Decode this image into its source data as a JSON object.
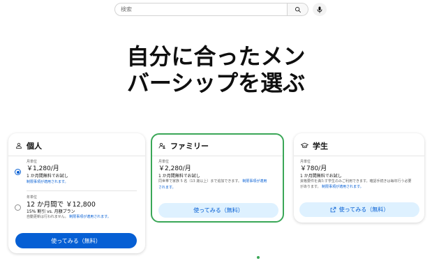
{
  "search": {
    "placeholder": "検索"
  },
  "headline": {
    "line1": "自分に合ったメン",
    "line2": "バーシップを選ぶ"
  },
  "individual": {
    "title": "個人",
    "monthly": {
      "label": "月単位",
      "price": "￥1,280/月",
      "trial": "1 か月間無料でお試し",
      "terms": "制限事項が適用されます。"
    },
    "annual": {
      "label": "年単位",
      "price": "12 か月間で ￥12,800",
      "discount": "15% 割引 vs. 月額プラン",
      "renewal_note": "自動更新は行われません。",
      "terms": "制限事項が適用されます。"
    },
    "button": "使ってみる（無料）"
  },
  "family": {
    "title": "ファミリー",
    "label": "月単位",
    "price": "￥2,280/月",
    "trial": "1 か月間無料でお試し",
    "desc": "同世帯で家族 5 名（13 歳以上）まで追加できます。",
    "terms_a": "制限事項が適用",
    "terms_b": "されます。",
    "button": "使ってみる（無料）"
  },
  "student": {
    "title": "学生",
    "label": "月単位",
    "price": "￥780/月",
    "trial": "1 か月間無料でお試し",
    "desc": "資格要件を満たす学生のみご利用できます。確認手続きは毎年行う必要",
    "desc2": "があります。",
    "terms": "制限事項が適用されます。",
    "button": "使ってみる（無料）"
  },
  "colors": {
    "accent": "#065fd4",
    "highlight": "#3aa757",
    "light_button": "#def1ff"
  },
  "icons": {
    "search": "search-icon",
    "mic": "mic-icon",
    "person": "person-icon",
    "family": "family-icon",
    "student": "graduation-cap-icon",
    "external": "external-link-icon"
  }
}
